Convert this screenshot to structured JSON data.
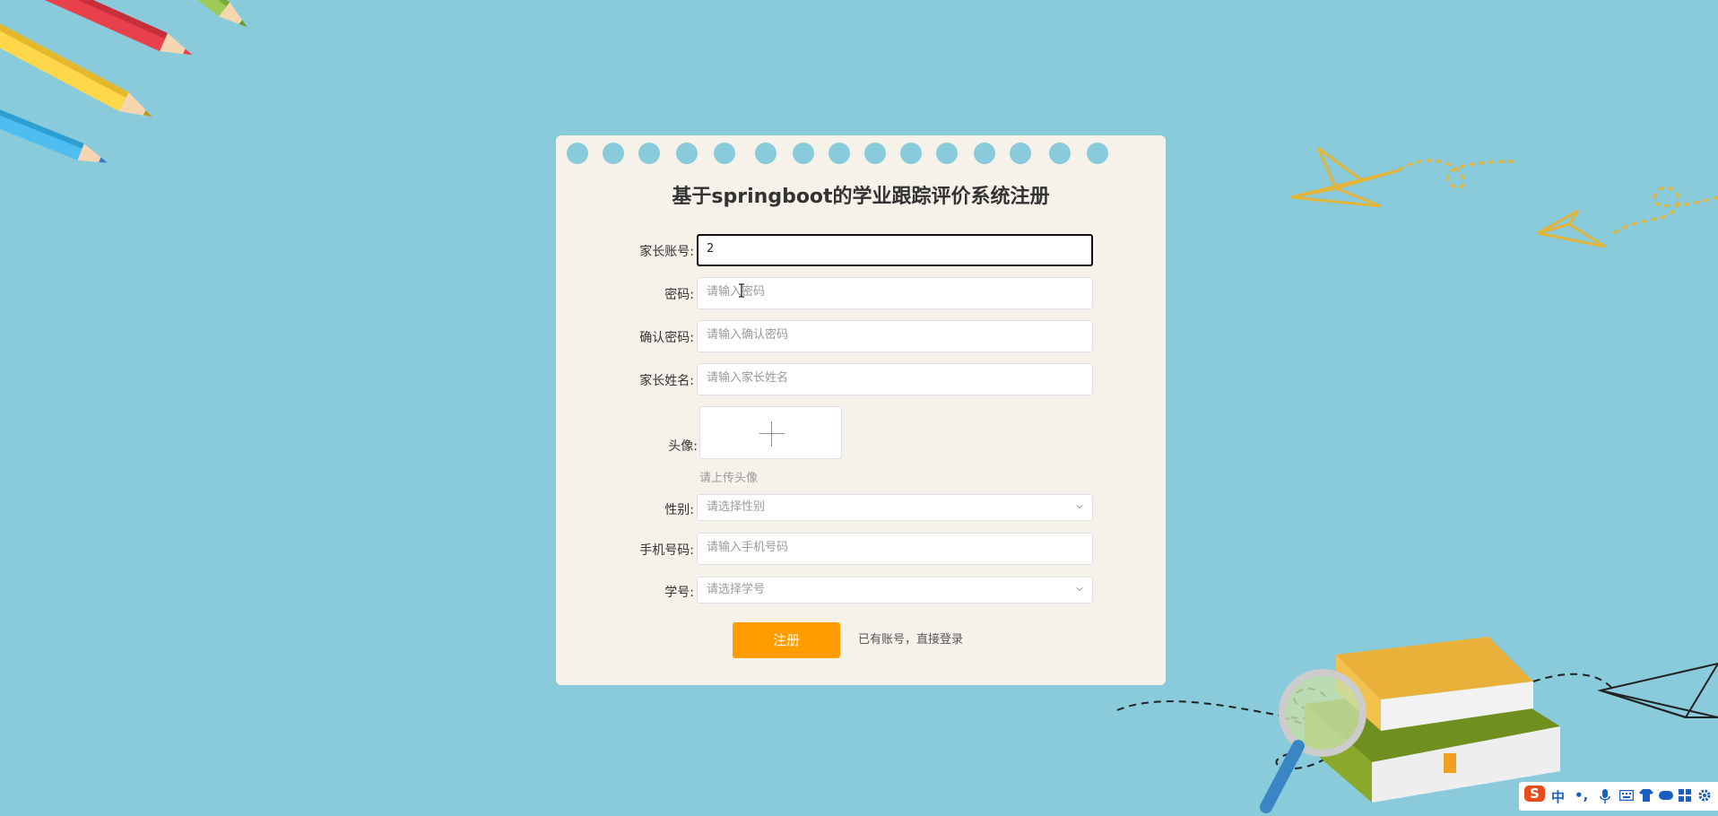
{
  "form": {
    "title": "基于springboot的学业跟踪评价系统注册",
    "account": {
      "label": "家长账号:",
      "value": "2"
    },
    "password": {
      "label": "密码:",
      "placeholder": "请输入密码"
    },
    "confirm_password": {
      "label": "确认密码:",
      "placeholder": "请输入确认密码"
    },
    "parent_name": {
      "label": "家长姓名:",
      "placeholder": "请输入家长姓名"
    },
    "avatar": {
      "label": "头像:",
      "tip": "请上传头像"
    },
    "gender": {
      "label": "性别:",
      "placeholder": "请选择性别"
    },
    "phone": {
      "label": "手机号码:",
      "placeholder": "请输入手机号码"
    },
    "student_id": {
      "label": "学号:",
      "placeholder": "请选择学号"
    },
    "register_button": "注册",
    "login_link": "已有账号，直接登录"
  },
  "ime_toolbar": {
    "mode": "中",
    "punct": "•,",
    "logo": "S"
  },
  "colors": {
    "background": "#89cbdb",
    "card": "#f6f1e9",
    "button": "#ff9d00"
  }
}
